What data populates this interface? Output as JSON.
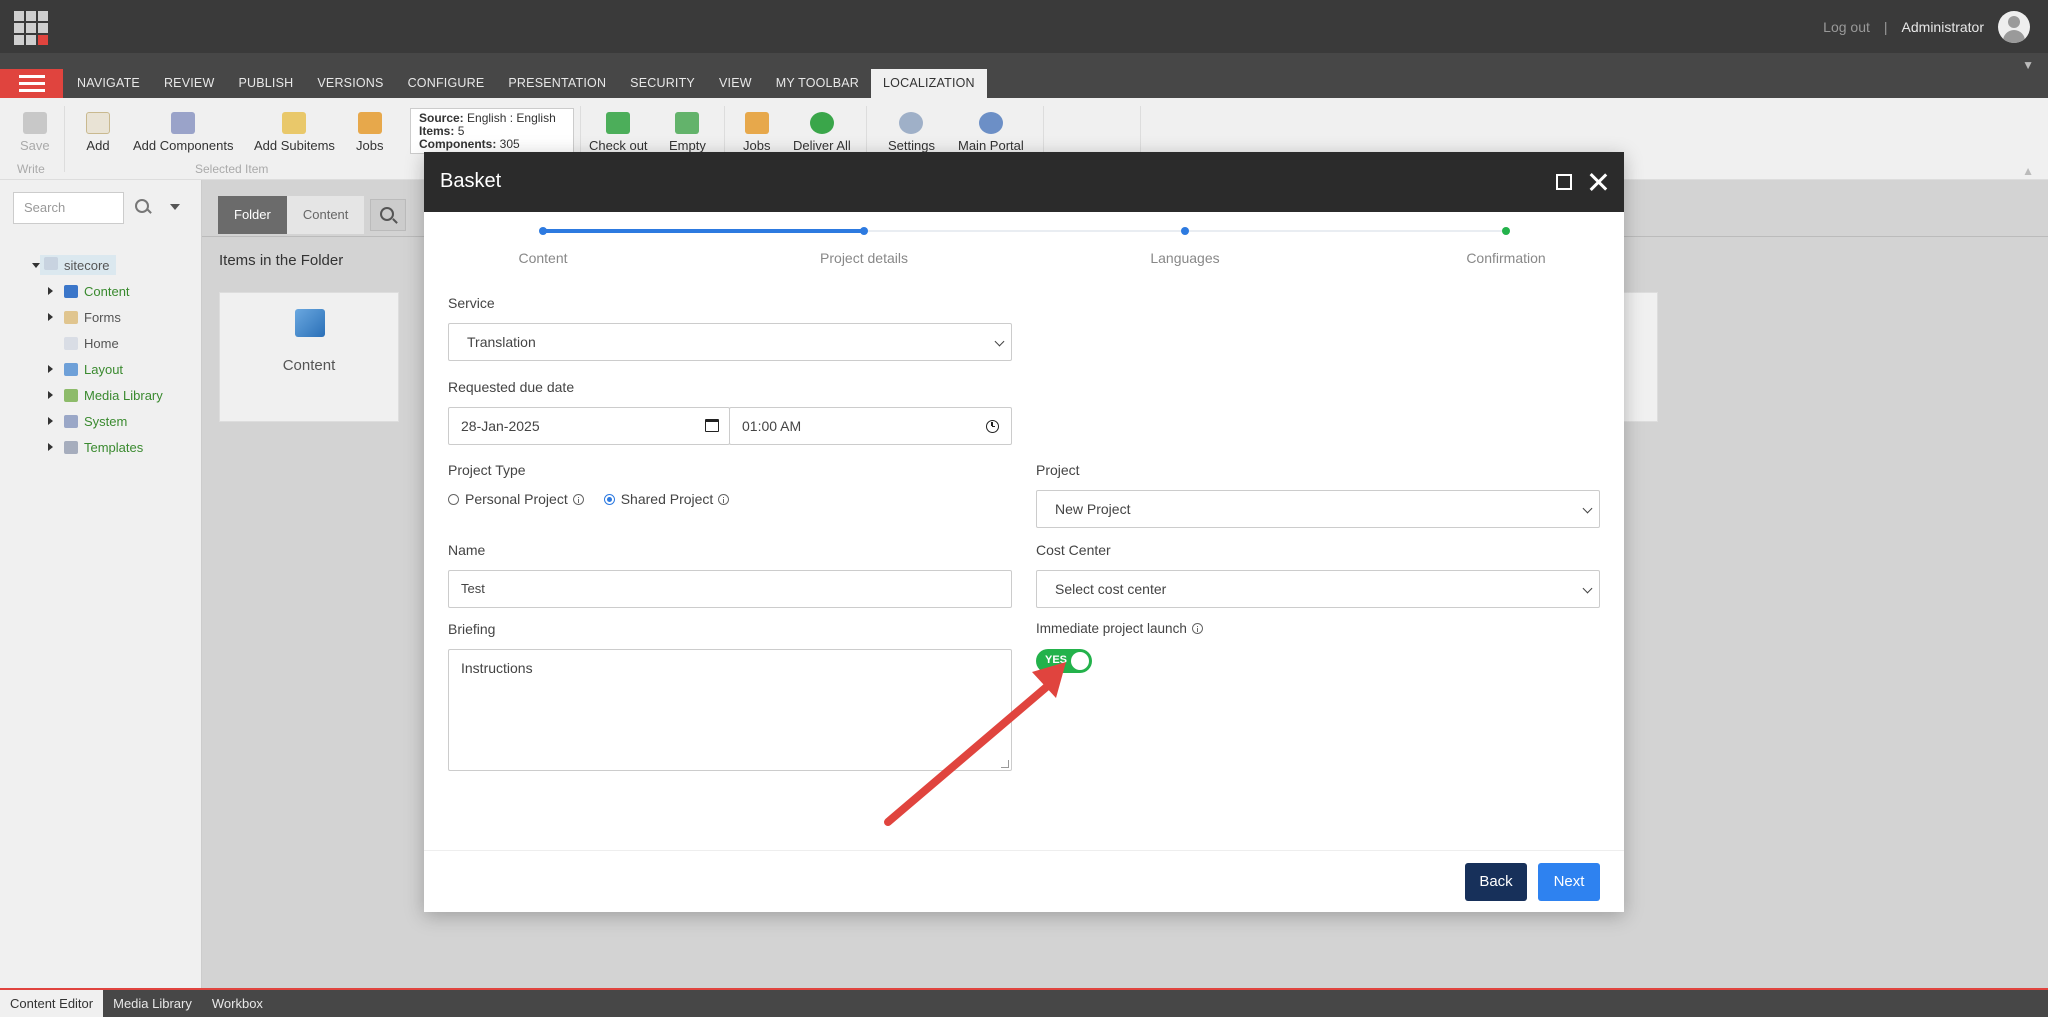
{
  "topbar": {
    "logout": "Log out",
    "separator": "|",
    "user": "Administrator"
  },
  "tabs": [
    "NAVIGATE",
    "REVIEW",
    "PUBLISH",
    "VERSIONS",
    "CONFIGURE",
    "PRESENTATION",
    "SECURITY",
    "VIEW",
    "MY TOOLBAR",
    "LOCALIZATION"
  ],
  "active_tab": "LOCALIZATION",
  "ribbon": {
    "save": "Save",
    "write": "Write",
    "add": "Add",
    "add_components": "Add Components",
    "add_subitems": "Add Subitems",
    "jobs1": "Jobs",
    "selected_item": "Selected Item",
    "source_label": "Source:",
    "source_value": "English : English",
    "items_label": "Items:",
    "items_value": "5",
    "components_label": "Components:",
    "components_value": "305",
    "check_out": "Check out",
    "empty": "Empty",
    "jobs2": "Jobs",
    "deliver_all": "Deliver All",
    "settings": "Settings",
    "main_portal": "Main Portal"
  },
  "left": {
    "search_placeholder": "Search",
    "tree_root": "sitecore",
    "tree": [
      "Content",
      "Forms",
      "Home",
      "Layout",
      "Media Library",
      "System",
      "Templates"
    ]
  },
  "main": {
    "tab_folder": "Folder",
    "tab_content": "Content",
    "items_title": "Items in the Folder",
    "tile_label": "Content"
  },
  "bottom_tabs": [
    "Content Editor",
    "Media Library",
    "Workbox"
  ],
  "modal": {
    "title": "Basket",
    "steps": [
      "Content",
      "Project details",
      "Languages",
      "Confirmation"
    ],
    "service_label": "Service",
    "service_value": "Translation",
    "due_label": "Requested due date",
    "due_date": "28-Jan-2025",
    "due_time": "01:00 AM",
    "project_type_label": "Project Type",
    "personal_project": "Personal Project",
    "shared_project": "Shared Project",
    "project_label": "Project",
    "project_value": "New Project",
    "name_label": "Name",
    "name_value": "Test",
    "cost_center_label": "Cost Center",
    "cost_center_placeholder": "Select cost center",
    "briefing_label": "Briefing",
    "briefing_value": "Instructions",
    "launch_label": "Immediate project launch",
    "toggle_text": "YES",
    "back": "Back",
    "next": "Next"
  },
  "colors": {
    "accent": "#e0443e",
    "primary": "#2e82f0",
    "navy": "#17305a",
    "toggle_on": "#23b24b"
  }
}
